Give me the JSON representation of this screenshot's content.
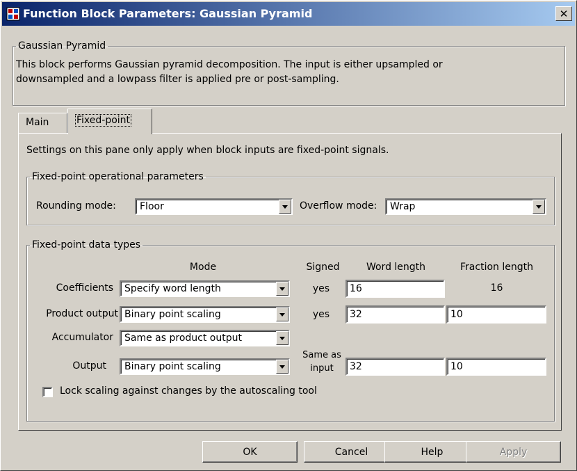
{
  "window": {
    "title": "Function Block Parameters: Gaussian Pyramid",
    "close_label": "✕"
  },
  "block": {
    "group_label": "Gaussian Pyramid",
    "description_line1": "This block performs Gaussian pyramid decomposition.  The input is either upsampled or",
    "description_line2": "downsampled and a lowpass filter is applied pre or post-sampling."
  },
  "tabs": [
    {
      "label": "Main"
    },
    {
      "label": "Fixed-point"
    }
  ],
  "pane": {
    "note": "Settings on this pane only apply when block inputs are fixed-point signals.",
    "op_params": {
      "legend": "Fixed-point operational parameters",
      "rounding_label": "Rounding mode:",
      "rounding_value": "Floor",
      "overflow_label": "Overflow mode:",
      "overflow_value": "Wrap"
    },
    "data_types": {
      "legend": "Fixed-point data types",
      "headers": {
        "mode": "Mode",
        "signed": "Signed",
        "word_length": "Word length",
        "fraction_length": "Fraction length"
      },
      "rows": [
        {
          "label": "Coefficients",
          "mode": "Specify word length",
          "signed": "yes",
          "word_length": "16",
          "fraction_length": "16"
        },
        {
          "label": "Product output",
          "mode": "Binary point scaling",
          "signed": "yes",
          "word_length": "32",
          "fraction_length": "10"
        },
        {
          "label": "Accumulator",
          "mode": "Same as product output"
        },
        {
          "label": "Output",
          "mode": "Binary point scaling",
          "signed_line1": "Same as",
          "signed_line2": "input",
          "word_length": "32",
          "fraction_length": "10"
        }
      ],
      "lock_scaling_label": "Lock scaling against changes by the autoscaling tool",
      "lock_scaling_checked": false
    }
  },
  "buttons": {
    "ok": "OK",
    "cancel": "Cancel",
    "help": "Help",
    "apply": "Apply"
  }
}
